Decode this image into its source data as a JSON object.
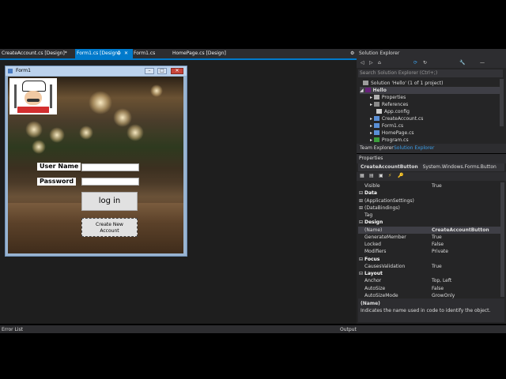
{
  "tabs": [
    {
      "label": "CreateAccount.cs [Design]*",
      "active": false
    },
    {
      "label": "Form1.cs [Design]",
      "active": true
    },
    {
      "label": "Form1.cs",
      "active": false
    },
    {
      "label": "HomePage.cs [Design]",
      "active": false
    }
  ],
  "tab_pin": "⊕",
  "tab_close": "✕",
  "form": {
    "title": "Form1",
    "username_label": "User Name",
    "password_label": "Password",
    "login_button": "log in",
    "create_line1": "Create New",
    "create_line2": "Account"
  },
  "solution_explorer": {
    "title": "Solution Explorer",
    "search_placeholder": "Search Solution Explorer (Ctrl+;)",
    "solution": "Solution 'Hello' (1 of 1 project)",
    "project": "Hello",
    "items": [
      "Properties",
      "References",
      "App.config",
      "CreateAccount.cs",
      "Form1.cs",
      "HomePage.cs",
      "Program.cs"
    ],
    "tab_team": "Team Explorer",
    "tab_solution": "Solution Explorer"
  },
  "properties": {
    "title": "Properties",
    "object_name": "CreateAccountButton",
    "object_type": "System.Windows.Forms.Button",
    "rows": [
      {
        "type": "prop",
        "k": "Visible",
        "v": "True"
      },
      {
        "type": "cat",
        "k": "Data",
        "v": ""
      },
      {
        "type": "prop",
        "k": "(ApplicationSettings)",
        "v": "",
        "expand": true
      },
      {
        "type": "prop",
        "k": "(DataBindings)",
        "v": "",
        "expand": true
      },
      {
        "type": "prop",
        "k": "Tag",
        "v": ""
      },
      {
        "type": "cat",
        "k": "Design",
        "v": ""
      },
      {
        "type": "prop",
        "k": "(Name)",
        "v": "CreateAccountButton",
        "bold": true
      },
      {
        "type": "prop",
        "k": "GenerateMember",
        "v": "True"
      },
      {
        "type": "prop",
        "k": "Locked",
        "v": "False"
      },
      {
        "type": "prop",
        "k": "Modifiers",
        "v": "Private"
      },
      {
        "type": "cat",
        "k": "Focus",
        "v": ""
      },
      {
        "type": "prop",
        "k": "CausesValidation",
        "v": "True"
      },
      {
        "type": "cat",
        "k": "Layout",
        "v": ""
      },
      {
        "type": "prop",
        "k": "Anchor",
        "v": "Top, Left"
      },
      {
        "type": "prop",
        "k": "AutoSize",
        "v": "False"
      },
      {
        "type": "prop",
        "k": "AutoSizeMode",
        "v": "GrowOnly"
      }
    ],
    "desc_title": "(Name)",
    "desc_text": "Indicates the name used in code to identify the object."
  },
  "bottom": {
    "error_list": "Error List",
    "output": "Output"
  },
  "colors": {
    "accent": "#007acc",
    "panel": "#252526",
    "editor": "#1e1e1e"
  }
}
